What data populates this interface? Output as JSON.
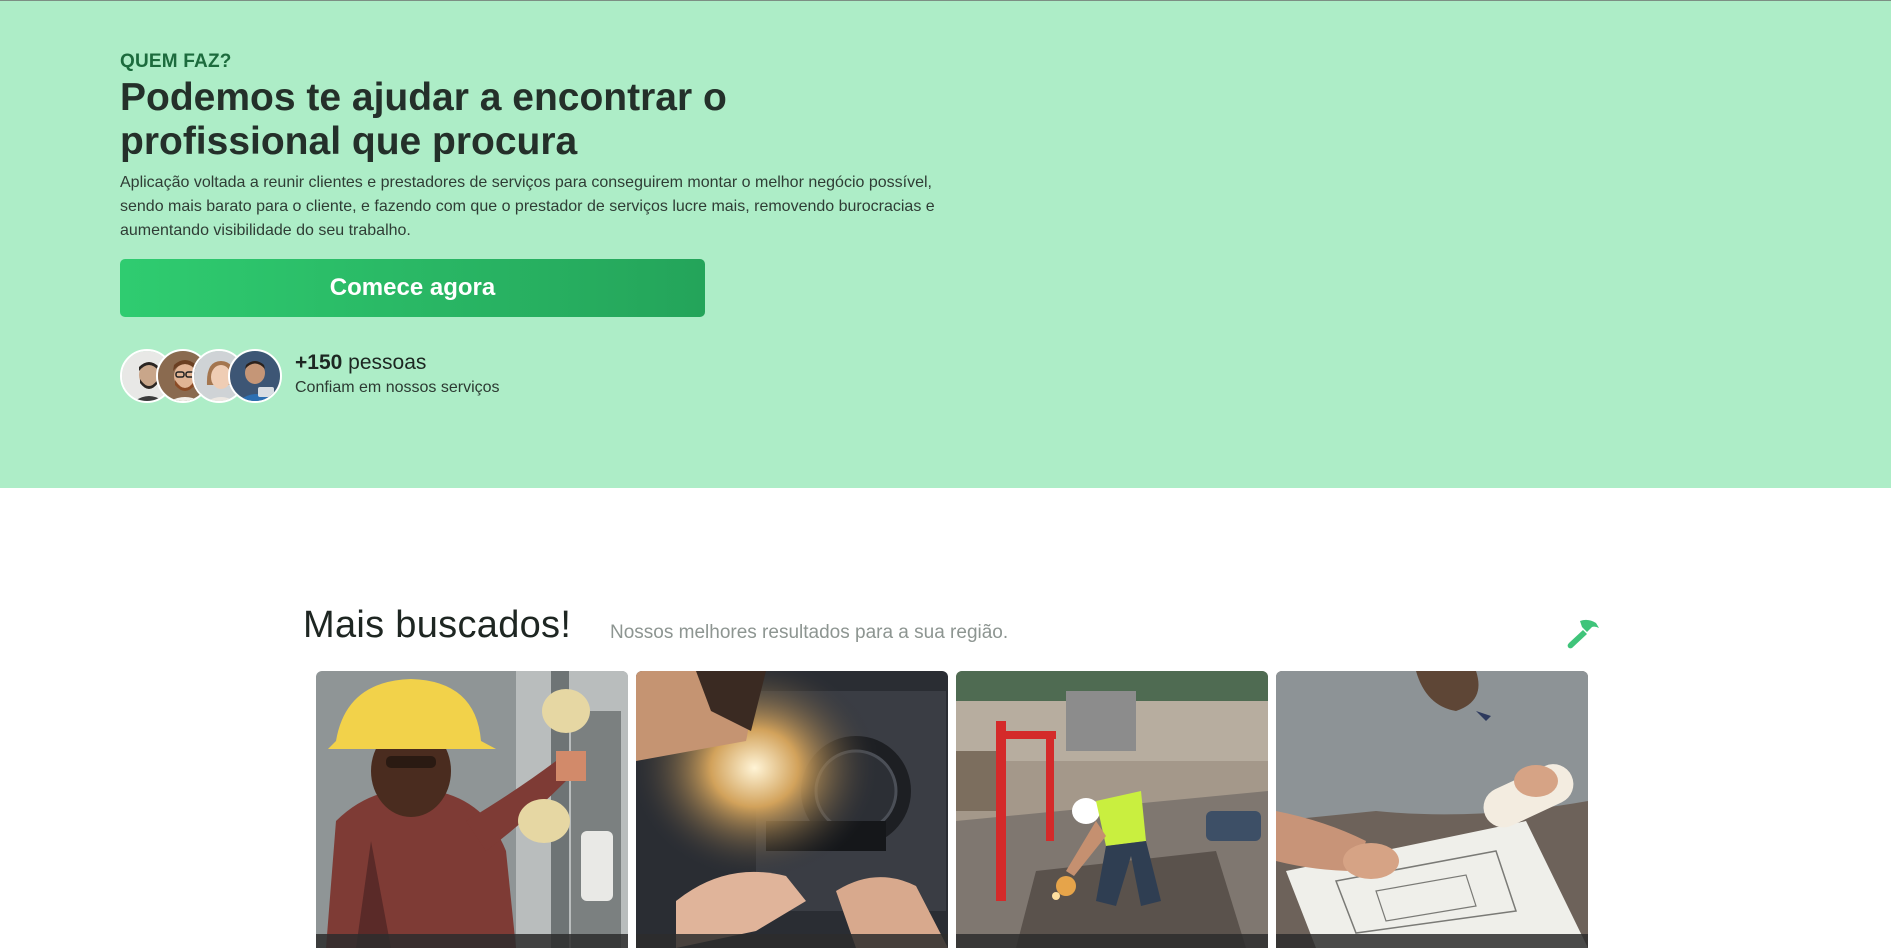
{
  "hero": {
    "eyebrow": "QUEM FAZ?",
    "title": "Podemos te ajudar a encontrar o profissional que procura",
    "description": "Aplicação voltada a reunir clientes e prestadores de serviços para conseguirem montar o melhor negócio possível, sendo mais barato para o cliente, e fazendo com que o prestador de serviços lucre mais, removendo burocracias e aumentando visibilidade do seu trabalho.",
    "cta_label": "Comece agora",
    "trust": {
      "count": "+150",
      "unit": "pessoas",
      "label": "Confiam em nossos serviços"
    }
  },
  "popular": {
    "title": "Mais buscados!",
    "subtitle": "Nossos melhores resultados para a sua região.",
    "icon": "hammer-icon",
    "cards": [
      {
        "icon": "electrician-photo"
      },
      {
        "icon": "computer-repair-photo"
      },
      {
        "icon": "construction-worker-photo"
      },
      {
        "icon": "architect-blueprint-photo"
      }
    ]
  },
  "colors": {
    "hero_bg": "#adedc7",
    "accent": "#2fcc70",
    "accent_dark": "#24a45a",
    "eyebrow": "#1c6b3d",
    "hammer": "#3fc47a"
  }
}
